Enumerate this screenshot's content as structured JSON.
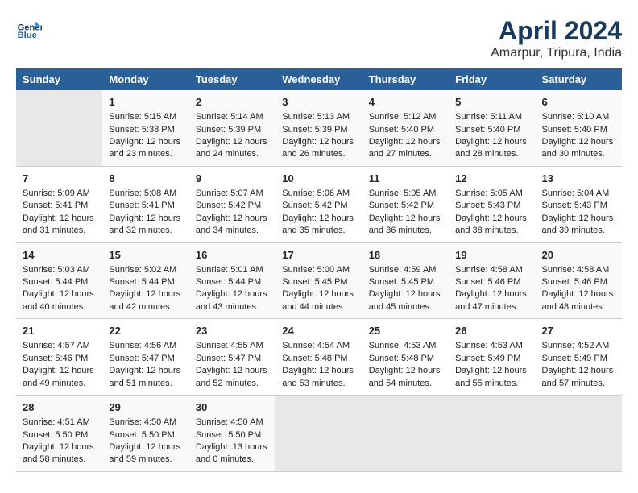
{
  "header": {
    "logo_line1": "General",
    "logo_line2": "Blue",
    "title": "April 2024",
    "subtitle": "Amarpur, Tripura, India"
  },
  "calendar": {
    "days_of_week": [
      "Sunday",
      "Monday",
      "Tuesday",
      "Wednesday",
      "Thursday",
      "Friday",
      "Saturday"
    ],
    "weeks": [
      [
        {
          "day": "",
          "empty": true
        },
        {
          "day": "1",
          "sunrise": "5:15 AM",
          "sunset": "5:38 PM",
          "daylight": "12 hours and 23 minutes."
        },
        {
          "day": "2",
          "sunrise": "5:14 AM",
          "sunset": "5:39 PM",
          "daylight": "12 hours and 24 minutes."
        },
        {
          "day": "3",
          "sunrise": "5:13 AM",
          "sunset": "5:39 PM",
          "daylight": "12 hours and 26 minutes."
        },
        {
          "day": "4",
          "sunrise": "5:12 AM",
          "sunset": "5:40 PM",
          "daylight": "12 hours and 27 minutes."
        },
        {
          "day": "5",
          "sunrise": "5:11 AM",
          "sunset": "5:40 PM",
          "daylight": "12 hours and 28 minutes."
        },
        {
          "day": "6",
          "sunrise": "5:10 AM",
          "sunset": "5:40 PM",
          "daylight": "12 hours and 30 minutes."
        }
      ],
      [
        {
          "day": "7",
          "sunrise": "5:09 AM",
          "sunset": "5:41 PM",
          "daylight": "12 hours and 31 minutes."
        },
        {
          "day": "8",
          "sunrise": "5:08 AM",
          "sunset": "5:41 PM",
          "daylight": "12 hours and 32 minutes."
        },
        {
          "day": "9",
          "sunrise": "5:07 AM",
          "sunset": "5:42 PM",
          "daylight": "12 hours and 34 minutes."
        },
        {
          "day": "10",
          "sunrise": "5:06 AM",
          "sunset": "5:42 PM",
          "daylight": "12 hours and 35 minutes."
        },
        {
          "day": "11",
          "sunrise": "5:05 AM",
          "sunset": "5:42 PM",
          "daylight": "12 hours and 36 minutes."
        },
        {
          "day": "12",
          "sunrise": "5:05 AM",
          "sunset": "5:43 PM",
          "daylight": "12 hours and 38 minutes."
        },
        {
          "day": "13",
          "sunrise": "5:04 AM",
          "sunset": "5:43 PM",
          "daylight": "12 hours and 39 minutes."
        }
      ],
      [
        {
          "day": "14",
          "sunrise": "5:03 AM",
          "sunset": "5:44 PM",
          "daylight": "12 hours and 40 minutes."
        },
        {
          "day": "15",
          "sunrise": "5:02 AM",
          "sunset": "5:44 PM",
          "daylight": "12 hours and 42 minutes."
        },
        {
          "day": "16",
          "sunrise": "5:01 AM",
          "sunset": "5:44 PM",
          "daylight": "12 hours and 43 minutes."
        },
        {
          "day": "17",
          "sunrise": "5:00 AM",
          "sunset": "5:45 PM",
          "daylight": "12 hours and 44 minutes."
        },
        {
          "day": "18",
          "sunrise": "4:59 AM",
          "sunset": "5:45 PM",
          "daylight": "12 hours and 45 minutes."
        },
        {
          "day": "19",
          "sunrise": "4:58 AM",
          "sunset": "5:46 PM",
          "daylight": "12 hours and 47 minutes."
        },
        {
          "day": "20",
          "sunrise": "4:58 AM",
          "sunset": "5:46 PM",
          "daylight": "12 hours and 48 minutes."
        }
      ],
      [
        {
          "day": "21",
          "sunrise": "4:57 AM",
          "sunset": "5:46 PM",
          "daylight": "12 hours and 49 minutes."
        },
        {
          "day": "22",
          "sunrise": "4:56 AM",
          "sunset": "5:47 PM",
          "daylight": "12 hours and 51 minutes."
        },
        {
          "day": "23",
          "sunrise": "4:55 AM",
          "sunset": "5:47 PM",
          "daylight": "12 hours and 52 minutes."
        },
        {
          "day": "24",
          "sunrise": "4:54 AM",
          "sunset": "5:48 PM",
          "daylight": "12 hours and 53 minutes."
        },
        {
          "day": "25",
          "sunrise": "4:53 AM",
          "sunset": "5:48 PM",
          "daylight": "12 hours and 54 minutes."
        },
        {
          "day": "26",
          "sunrise": "4:53 AM",
          "sunset": "5:49 PM",
          "daylight": "12 hours and 55 minutes."
        },
        {
          "day": "27",
          "sunrise": "4:52 AM",
          "sunset": "5:49 PM",
          "daylight": "12 hours and 57 minutes."
        }
      ],
      [
        {
          "day": "28",
          "sunrise": "4:51 AM",
          "sunset": "5:50 PM",
          "daylight": "12 hours and 58 minutes."
        },
        {
          "day": "29",
          "sunrise": "4:50 AM",
          "sunset": "5:50 PM",
          "daylight": "12 hours and 59 minutes."
        },
        {
          "day": "30",
          "sunrise": "4:50 AM",
          "sunset": "5:50 PM",
          "daylight": "13 hours and 0 minutes."
        },
        {
          "day": "",
          "empty": true
        },
        {
          "day": "",
          "empty": true
        },
        {
          "day": "",
          "empty": true
        },
        {
          "day": "",
          "empty": true
        }
      ]
    ],
    "labels": {
      "sunrise": "Sunrise:",
      "sunset": "Sunset:",
      "daylight": "Daylight:"
    }
  }
}
